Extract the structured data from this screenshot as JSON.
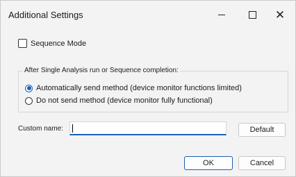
{
  "window": {
    "title": "Additional Settings",
    "controls": {
      "minimize": "minimize-icon",
      "maximize": "maximize-icon",
      "close": "close-icon"
    }
  },
  "sequence_mode": {
    "label": "Sequence Mode",
    "checked": false
  },
  "group": {
    "label": "After Single Analysis run or Sequence completion:",
    "options": [
      {
        "label": "Automatically send method (device monitor functions limited)",
        "selected": true
      },
      {
        "label": "Do not send method (device monitor fully functional)",
        "selected": false
      }
    ]
  },
  "custom_name": {
    "label": "Custom name:",
    "value": ""
  },
  "buttons": {
    "default": "Default",
    "ok": "OK",
    "cancel": "Cancel"
  },
  "colors": {
    "accent": "#1a5fb4",
    "background": "#f3f3f3"
  }
}
